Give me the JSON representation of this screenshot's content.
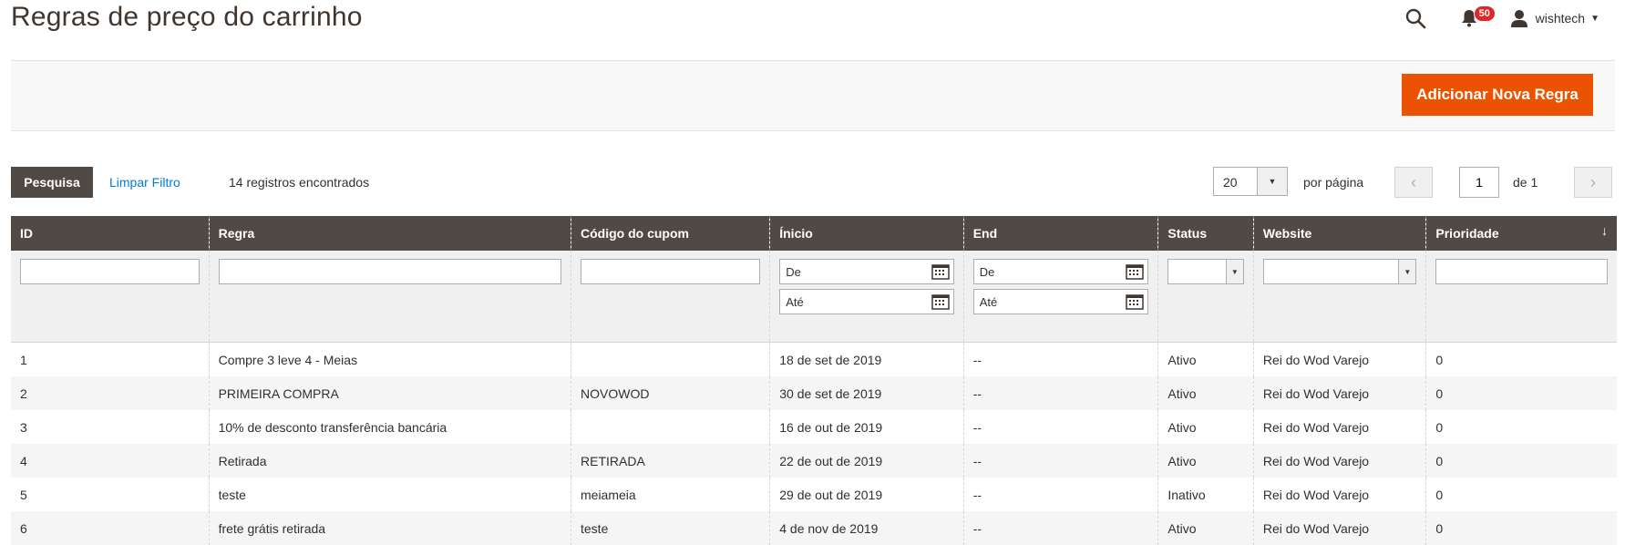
{
  "header": {
    "title": "Regras de preço do carrinho",
    "notifications_count": "50",
    "username": "wishtech"
  },
  "action_bar": {
    "add_rule_label": "Adicionar Nova Regra"
  },
  "toolbar": {
    "search_label": "Pesquisa",
    "clear_filter_label": "Limpar Filtro",
    "records_found": "14 registros encontrados",
    "per_page_value": "20",
    "per_page_label": "por página",
    "current_page": "1",
    "page_total": "de 1"
  },
  "grid": {
    "columns": [
      "ID",
      "Regra",
      "Código do cupom",
      "Ínicio",
      "End",
      "Status",
      "Website",
      "Prioridade"
    ],
    "filters": {
      "date_from_placeholder": "De",
      "date_to_placeholder": "Até"
    },
    "rows": [
      {
        "id": "1",
        "rule": "Compre 3 leve 4 - Meias",
        "coupon": "",
        "start": "18 de set de 2019",
        "end": "--",
        "status": "Ativo",
        "website": "Rei do Wod Varejo",
        "priority": "0"
      },
      {
        "id": "2",
        "rule": "PRIMEIRA COMPRA",
        "coupon": "NOVOWOD",
        "start": "30 de set de 2019",
        "end": "--",
        "status": "Ativo",
        "website": "Rei do Wod Varejo",
        "priority": "0"
      },
      {
        "id": "3",
        "rule": "10% de desconto transferência bancária",
        "coupon": "",
        "start": "16 de out de 2019",
        "end": "--",
        "status": "Ativo",
        "website": "Rei do Wod Varejo",
        "priority": "0"
      },
      {
        "id": "4",
        "rule": "Retirada",
        "coupon": "RETIRADA",
        "start": "22 de out de 2019",
        "end": "--",
        "status": "Ativo",
        "website": "Rei do Wod Varejo",
        "priority": "0"
      },
      {
        "id": "5",
        "rule": "teste",
        "coupon": "meiameia",
        "start": "29 de out de 2019",
        "end": "--",
        "status": "Inativo",
        "website": "Rei do Wod Varejo",
        "priority": "0"
      },
      {
        "id": "6",
        "rule": "frete grátis retirada",
        "coupon": "teste",
        "start": "4 de nov de 2019",
        "end": "--",
        "status": "Ativo",
        "website": "Rei do Wod Varejo",
        "priority": "0"
      }
    ]
  },
  "colors": {
    "accent": "#eb5202",
    "header_bg": "#514943",
    "link": "#007bdb",
    "badge": "#e22626"
  },
  "icons": [
    "search-icon",
    "bell-icon",
    "user-icon",
    "calendar-icon",
    "chevron-left-icon",
    "chevron-right-icon",
    "chevron-down-icon",
    "sort-arrow-icon"
  ]
}
